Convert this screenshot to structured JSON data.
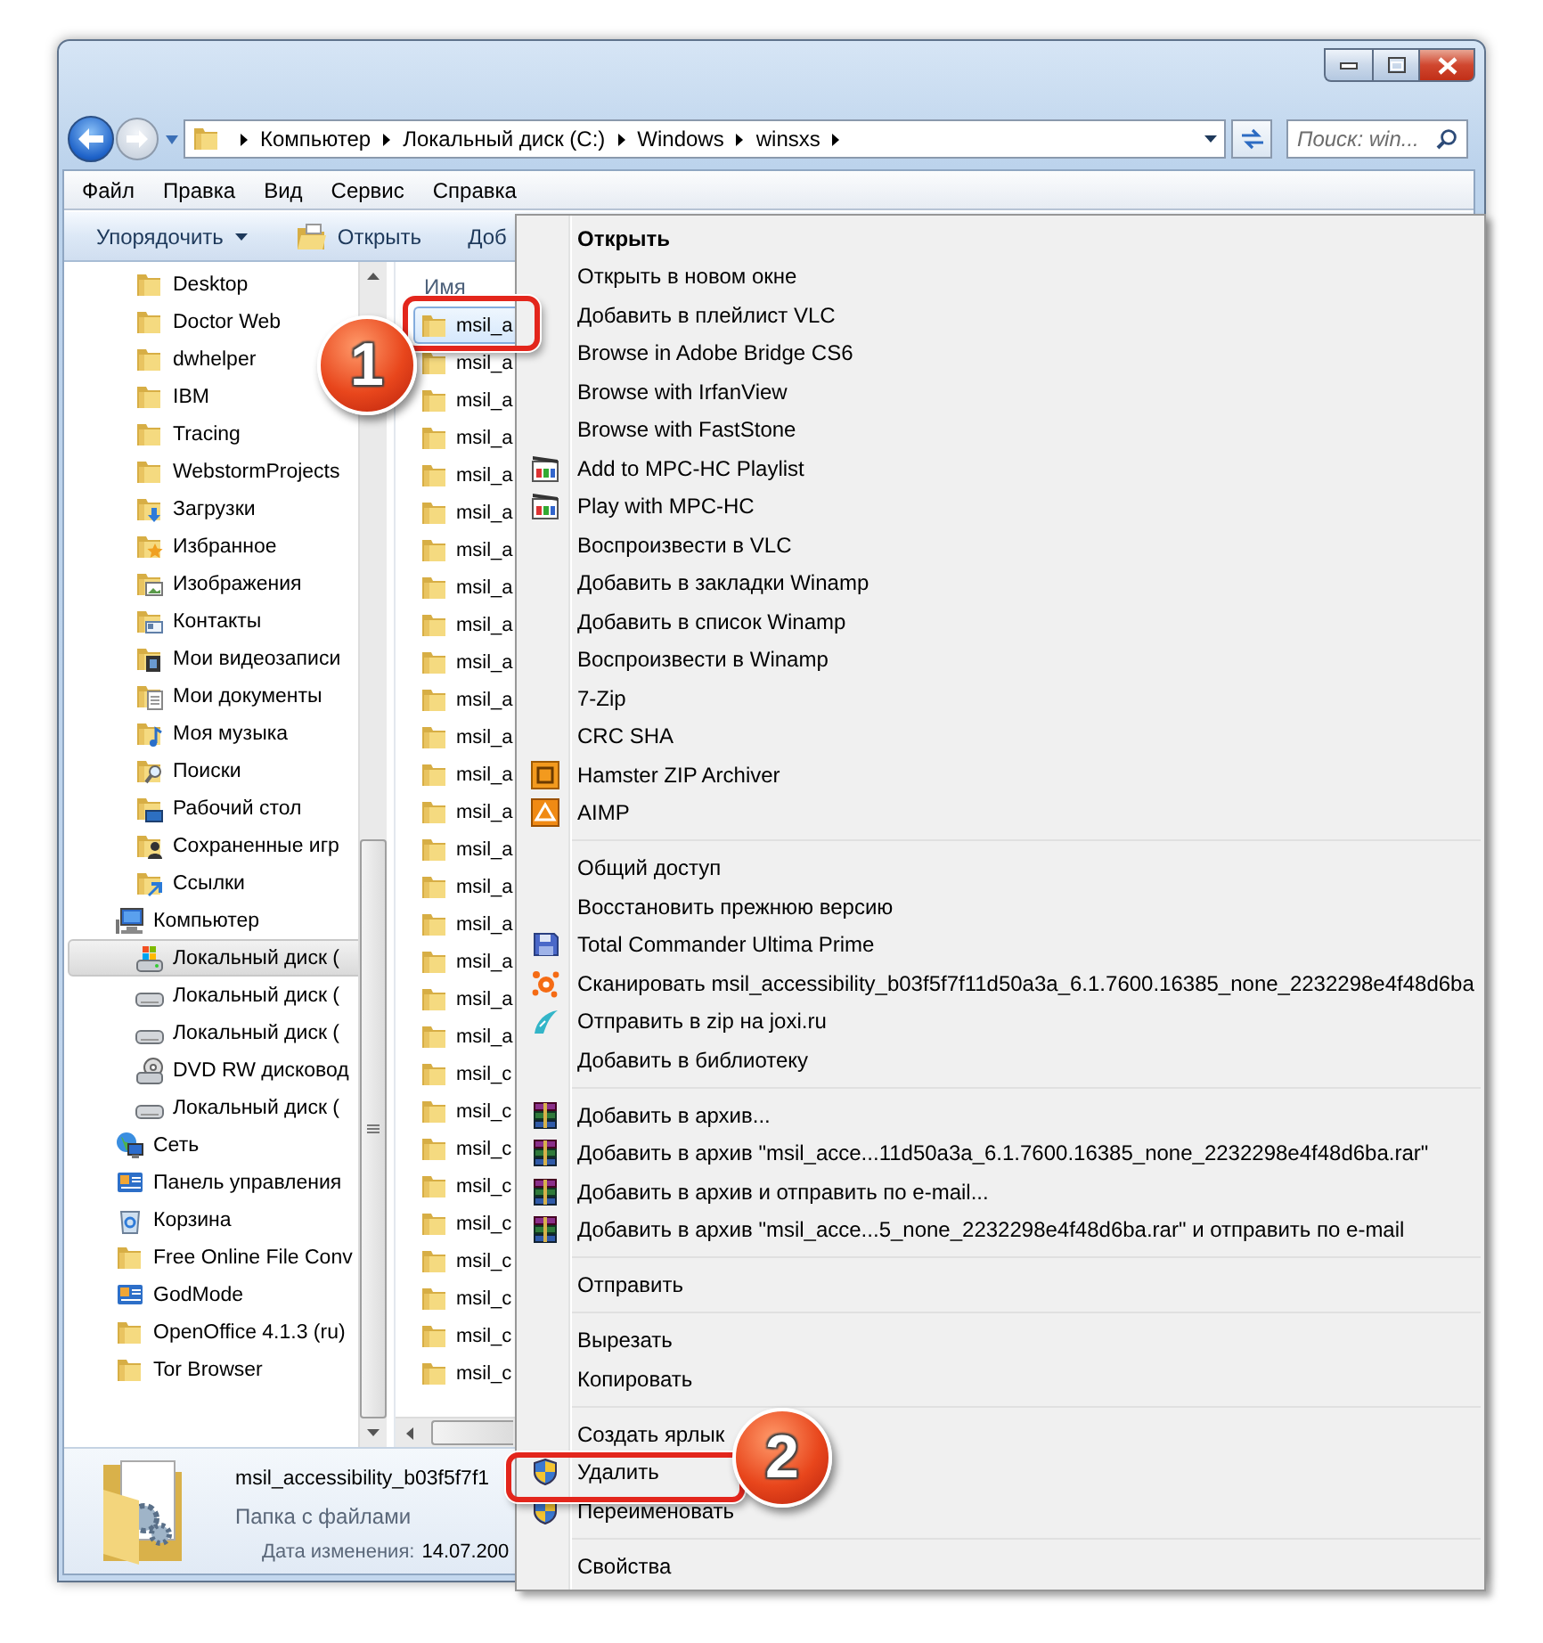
{
  "address_bar": {
    "breadcrumbs": [
      "Компьютер",
      "Локальный диск (C:)",
      "Windows",
      "winsxs"
    ]
  },
  "search": {
    "placeholder": "Поиск: win..."
  },
  "menu_bar": [
    "Файл",
    "Правка",
    "Вид",
    "Сервис",
    "Справка"
  ],
  "toolbar": [
    {
      "label": "Упорядочить",
      "kind": "menu"
    },
    {
      "label": "Открыть",
      "kind": "open"
    },
    {
      "label": "Доб",
      "kind": "plain"
    }
  ],
  "nav_pane": {
    "upper_items": [
      {
        "label": "Desktop",
        "kind": "folder",
        "selected": false
      },
      {
        "label": "Doctor Web",
        "kind": "folder",
        "selected": false
      },
      {
        "label": "dwhelper",
        "kind": "folder",
        "selected": false
      },
      {
        "label": "IBM",
        "kind": "folder",
        "selected": false
      },
      {
        "label": "Tracing",
        "kind": "folder",
        "selected": false
      },
      {
        "label": "WebstormProjects",
        "kind": "folder",
        "selected": false
      },
      {
        "label": "Загрузки",
        "kind": "downloads",
        "selected": false
      },
      {
        "label": "Избранное",
        "kind": "favorites",
        "selected": false
      },
      {
        "label": "Изображения",
        "kind": "pictures",
        "selected": false
      },
      {
        "label": "Контакты",
        "kind": "contacts",
        "selected": false
      },
      {
        "label": "Мои видеозаписи",
        "kind": "videos",
        "selected": false
      },
      {
        "label": "Мои документы",
        "kind": "documents",
        "selected": false
      },
      {
        "label": "Моя музыка",
        "kind": "music",
        "selected": false
      },
      {
        "label": "Поиски",
        "kind": "searches",
        "selected": false
      },
      {
        "label": "Рабочий стол",
        "kind": "desktop",
        "selected": false
      },
      {
        "label": "Сохраненные игр",
        "kind": "games",
        "selected": false
      },
      {
        "label": "Ссылки",
        "kind": "links",
        "selected": false
      }
    ],
    "items": [
      {
        "label": "Компьютер",
        "kind": "computer",
        "selected": false,
        "children": [
          {
            "label": "Локальный диск (",
            "kind": "system-drive",
            "selected": true
          },
          {
            "label": "Локальный диск (",
            "kind": "drive",
            "selected": false
          },
          {
            "label": "Локальный диск (",
            "kind": "drive",
            "selected": false
          },
          {
            "label": "DVD RW дисковод",
            "kind": "dvd",
            "selected": false
          },
          {
            "label": "Локальный диск (",
            "kind": "drive",
            "selected": false
          }
        ]
      },
      {
        "label": "Сеть",
        "kind": "network",
        "selected": false
      },
      {
        "label": "Панель управления",
        "kind": "control-panel",
        "selected": false
      },
      {
        "label": "Корзина",
        "kind": "recycle-bin",
        "selected": false
      },
      {
        "label": "Free Online File Conv",
        "kind": "folder",
        "selected": false
      },
      {
        "label": "GodMode",
        "kind": "control-panel",
        "selected": false
      },
      {
        "label": "OpenOffice 4.1.3 (ru)",
        "kind": "folder",
        "selected": false
      },
      {
        "label": "Tor Browser",
        "kind": "folder",
        "selected": false
      }
    ]
  },
  "file_list": {
    "columns": [
      "Имя"
    ],
    "rows": [
      {
        "name": "msil_a",
        "selected": true
      },
      {
        "name": "msil_a",
        "selected": false
      },
      {
        "name": "msil_a",
        "selected": false
      },
      {
        "name": "msil_a",
        "selected": false
      },
      {
        "name": "msil_a",
        "selected": false
      },
      {
        "name": "msil_a",
        "selected": false
      },
      {
        "name": "msil_a",
        "selected": false
      },
      {
        "name": "msil_a",
        "selected": false
      },
      {
        "name": "msil_a",
        "selected": false
      },
      {
        "name": "msil_a",
        "selected": false
      },
      {
        "name": "msil_a",
        "selected": false
      },
      {
        "name": "msil_a",
        "selected": false
      },
      {
        "name": "msil_a",
        "selected": false
      },
      {
        "name": "msil_a",
        "selected": false
      },
      {
        "name": "msil_a",
        "selected": false
      },
      {
        "name": "msil_a",
        "selected": false
      },
      {
        "name": "msil_a",
        "selected": false
      },
      {
        "name": "msil_a",
        "selected": false
      },
      {
        "name": "msil_a",
        "selected": false
      },
      {
        "name": "msil_a",
        "selected": false
      },
      {
        "name": "msil_c",
        "selected": false
      },
      {
        "name": "msil_c",
        "selected": false
      },
      {
        "name": "msil_c",
        "selected": false
      },
      {
        "name": "msil_c",
        "selected": false
      },
      {
        "name": "msil_c",
        "selected": false
      },
      {
        "name": "msil_c",
        "selected": false
      },
      {
        "name": "msil_c",
        "selected": false
      },
      {
        "name": "msil_c",
        "selected": false
      },
      {
        "name": "msil_c",
        "selected": false
      }
    ]
  },
  "details": {
    "name": "msil_accessibility_b03f5f7f1",
    "type": "Папка с файлами",
    "date_label": "Дата изменения:",
    "date_value": "14.07.200"
  },
  "context_menu": {
    "groups": [
      [
        {
          "label": "Открыть",
          "kind": "default"
        },
        {
          "label": "Открыть в новом окне",
          "kind": "plain"
        },
        {
          "label": "Добавить в плейлист VLC",
          "kind": "plain"
        },
        {
          "label": "Browse in Adobe Bridge CS6",
          "kind": "plain"
        },
        {
          "label": "Browse with IrfanView",
          "kind": "plain"
        },
        {
          "label": "Browse with FastStone",
          "kind": "plain"
        },
        {
          "label": "Add to MPC-HC Playlist",
          "kind": "mpc"
        },
        {
          "label": "Play with MPC-HC",
          "kind": "mpc"
        },
        {
          "label": "Воспроизвести в VLC",
          "kind": "plain"
        },
        {
          "label": "Добавить в закладки Winamp",
          "kind": "plain"
        },
        {
          "label": "Добавить в список Winamp",
          "kind": "plain"
        },
        {
          "label": "Воспроизвести в Winamp",
          "kind": "plain"
        },
        {
          "label": "7-Zip",
          "kind": "plain"
        },
        {
          "label": "CRC SHA",
          "kind": "plain"
        },
        {
          "label": "Hamster ZIP Archiver",
          "kind": "hamster"
        },
        {
          "label": "AIMP",
          "kind": "aimp"
        }
      ],
      [
        {
          "label": "Общий доступ",
          "kind": "plain"
        },
        {
          "label": "Восстановить прежнюю версию",
          "kind": "plain"
        },
        {
          "label": "Total Commander Ultima Prime",
          "kind": "totalcmd"
        },
        {
          "label": "Сканировать msil_accessibility_b03f5f7f11d50a3a_6.1.7600.16385_none_2232298e4f48d6ba",
          "kind": "antivirus"
        },
        {
          "label": "Отправить в zip на joxi.ru",
          "kind": "joxi"
        },
        {
          "label": "Добавить в библиотеку",
          "kind": "plain"
        }
      ],
      [
        {
          "label": "Добавить в архив...",
          "kind": "winrar"
        },
        {
          "label": "Добавить в архив \"msil_acce...11d50a3a_6.1.7600.16385_none_2232298e4f48d6ba.rar\"",
          "kind": "winrar"
        },
        {
          "label": "Добавить в архив и отправить по e-mail...",
          "kind": "winrar"
        },
        {
          "label": "Добавить в архив \"msil_acce...5_none_2232298e4f48d6ba.rar\" и отправить по e-mail",
          "kind": "winrar"
        }
      ],
      [
        {
          "label": "Отправить",
          "kind": "plain"
        }
      ],
      [
        {
          "label": "Вырезать",
          "kind": "plain"
        },
        {
          "label": "Копировать",
          "kind": "plain"
        }
      ],
      [
        {
          "label": "Создать ярлык",
          "kind": "plain"
        },
        {
          "label": "Удалить",
          "kind": "shield"
        },
        {
          "label": "Переименовать",
          "kind": "shield"
        }
      ],
      [
        {
          "label": "Свойства",
          "kind": "plain"
        }
      ]
    ]
  },
  "annotations": [
    {
      "number": "1"
    },
    {
      "number": "2"
    }
  ]
}
